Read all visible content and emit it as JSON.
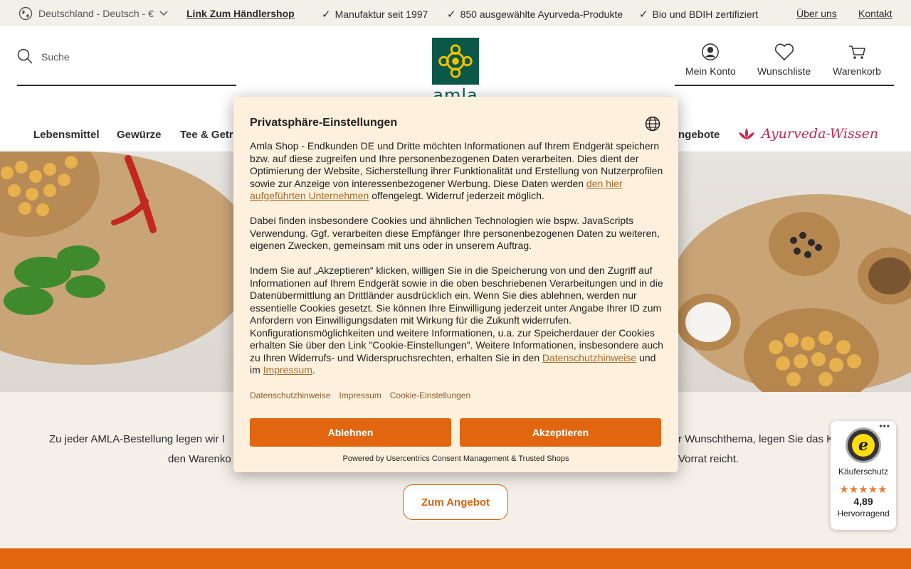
{
  "topbar": {
    "locale": "Deutschland - Deutsch - €",
    "dealer_link": "Link Zum Händlershop",
    "usps": [
      "Manufaktur seit 1997",
      "850 ausgewählte Ayurveda-Produkte",
      "Bio und BDIH zertifiziert"
    ],
    "about": "Über uns",
    "contact": "Kontakt"
  },
  "header": {
    "search_placeholder": "Suche",
    "logo_text": "amla",
    "account": "Mein Konto",
    "wishlist": "Wunschliste",
    "cart": "Warenkorb"
  },
  "nav": {
    "items": [
      "Lebensmittel",
      "Gewürze",
      "Tee & Getr",
      "ngebote"
    ],
    "wissen": "Ayurveda-Wissen"
  },
  "promo": {
    "line1_left": "Zu jeder AMLA-Bestellung legen wir I",
    "line1_right": "r Wunschthema, legen Sie das K",
    "line2_left": "den Warenko",
    "line2_right": "Vorrat reicht.",
    "cta": "Zum Angebot"
  },
  "trusted": {
    "label": "Käuferschutz",
    "stars": "★★★★★",
    "rating": "4,89",
    "grade": "Hervorragend"
  },
  "consent": {
    "title": "Privatsphäre-Einstellungen",
    "p1_before": "Amla Shop - Endkunden DE und Dritte möchten Informationen auf Ihrem Endgerät speichern bzw. auf diese zugreifen und Ihre personenbezogenen Daten verarbeiten. Dies dient der Optimierung der Website, Sicherstellung ihrer Funktionalität und Erstellung von Nutzerprofilen sowie zur Anzeige von interessenbezogener Werbung. Diese Daten werden ",
    "p1_link": "den hier aufgeführten Unternehmen",
    "p1_after": " offengelegt. Widerruf jederzeit möglich.",
    "p2": "Dabei finden insbesondere Cookies und ähnlichen Technologien wie bspw. JavaScripts Verwendung. Ggf. verarbeiten diese Empfänger Ihre personenbezogenen Daten zu weiteren, eigenen Zwecken, gemeinsam mit uns oder in unserem Auftrag.",
    "p3_before": "Indem Sie auf „Akzeptieren“ klicken, willigen Sie in die Speicherung von und den Zugriff auf Informationen auf Ihrem Endgerät sowie in die oben beschriebenen Verarbeitungen und in die Datenübermittlung an Drittländer ausdrücklich ein. Wenn Sie dies ablehnen, werden nur essentielle Cookies gesetzt. Sie können Ihre Einwilligung jederzeit unter Angabe Ihrer ID zum Anfordern von Einwilligungsdaten mit Wirkung für die Zukunft widerrufen. Konfigurationsmöglichkeiten und weitere Informationen, u.a. zur Speicherdauer der Cookies erhalten Sie über den Link \"Cookie-Einstellungen\". Weitere Informationen, insbesondere auch zu Ihren Widerrufs- und Widerspruchsrechten, erhalten Sie in den ",
    "p3_link1": "Datenschutzhinweise",
    "p3_mid": " und im ",
    "p3_link2": "Impressum",
    "p3_end": ".",
    "links": [
      "Datenschutzhinweise",
      "Impressum",
      "Cookie-Einstellungen"
    ],
    "decline": "Ablehnen",
    "accept": "Akzeptieren",
    "powered": "Powered by Usercentrics Consent Management & Trusted Shops"
  }
}
